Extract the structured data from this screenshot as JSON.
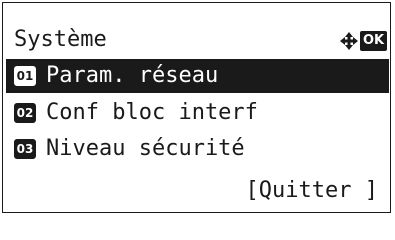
{
  "header": {
    "title": "Système",
    "nav_icon": "four-way-arrows-icon",
    "ok_label": "OK"
  },
  "menu": {
    "items": [
      {
        "number": "01",
        "label": "Param. réseau",
        "selected": true
      },
      {
        "number": "02",
        "label": "Conf bloc interf",
        "selected": false
      },
      {
        "number": "03",
        "label": "Niveau sécurité",
        "selected": false
      }
    ]
  },
  "footer": {
    "quit_label": "[Quitter ]"
  },
  "colors": {
    "foreground": "#1a1a1a",
    "background": "#ffffff"
  }
}
